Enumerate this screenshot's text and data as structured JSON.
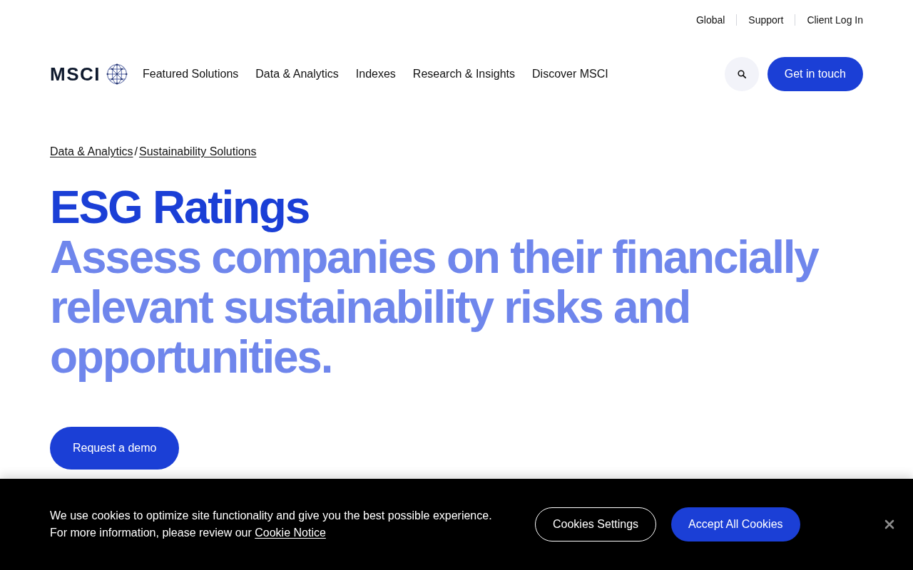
{
  "utility_nav": [
    {
      "label": "Global"
    },
    {
      "label": "Support"
    },
    {
      "label": "Client Log In"
    }
  ],
  "logo": {
    "text": "MSCI"
  },
  "main_nav": [
    {
      "label": "Featured Solutions"
    },
    {
      "label": "Data & Analytics"
    },
    {
      "label": "Indexes"
    },
    {
      "label": "Research & Insights"
    },
    {
      "label": "Discover MSCI"
    }
  ],
  "contact_button": "Get in touch",
  "breadcrumb": {
    "items": [
      {
        "label": "Data & Analytics"
      },
      {
        "label": "Sustainability Solutions"
      }
    ],
    "separator": "/"
  },
  "hero": {
    "title": "ESG Ratings",
    "subtitle": "Assess companies on their financially relevant sustainability risks and opportunities.",
    "button": "Request a demo"
  },
  "cookie_banner": {
    "message": [
      "We use cookies to optimize site functionality and give you the best possible experience.",
      "For more information, please review our"
    ],
    "link": "Cookie Notice",
    "buttons": [
      {
        "label": "Cookies Settings",
        "kind": "outline"
      },
      {
        "label": "Accept All Cookies",
        "kind": "primary"
      }
    ]
  }
}
